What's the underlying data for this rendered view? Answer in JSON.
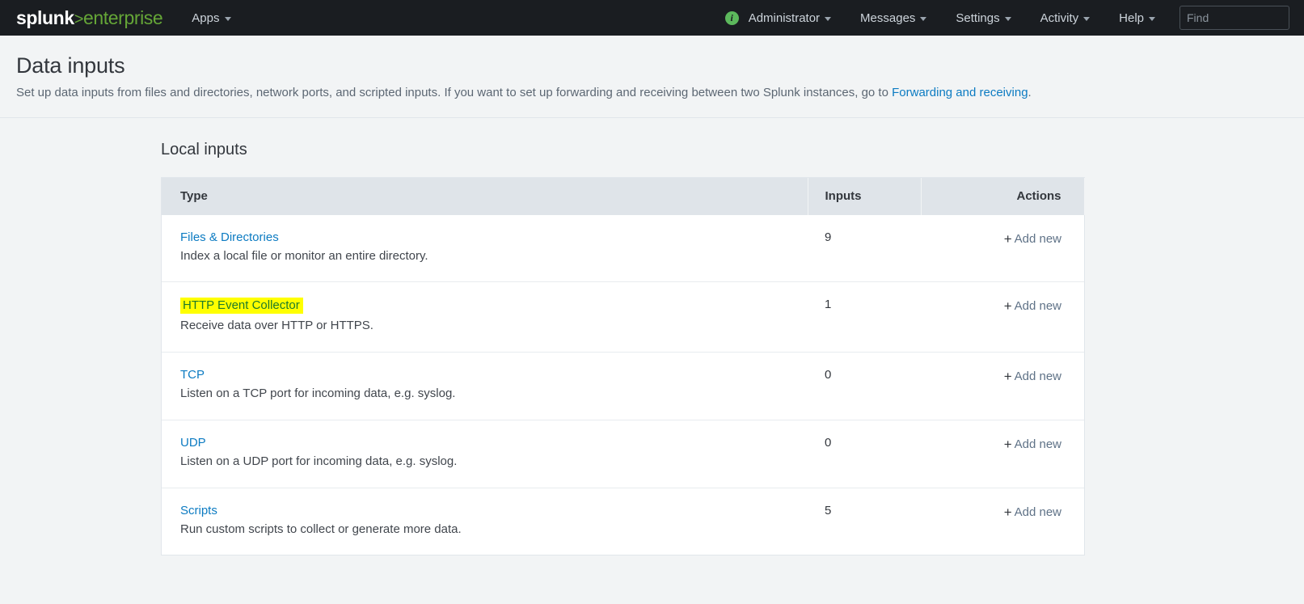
{
  "appbar": {
    "logo": {
      "part1": "splunk",
      "part2": ">",
      "part3": "enterprise"
    },
    "apps_label": "Apps",
    "info_glyph": "i",
    "items": [
      {
        "label": "Administrator"
      },
      {
        "label": "Messages"
      },
      {
        "label": "Settings"
      },
      {
        "label": "Activity"
      },
      {
        "label": "Help"
      }
    ],
    "find": {
      "placeholder": "Find",
      "value": ""
    }
  },
  "page": {
    "title": "Data inputs",
    "description_before": "Set up data inputs from files and directories, network ports, and scripted inputs. If you want to set up forwarding and receiving between two Splunk instances, go to ",
    "description_link": "Forwarding and receiving",
    "description_after": "."
  },
  "section": {
    "title": "Local inputs",
    "columns": {
      "type": "Type",
      "inputs": "Inputs",
      "actions": "Actions"
    },
    "action_label": "Add new",
    "action_plus": "+",
    "rows": [
      {
        "name": "Files & Directories",
        "description": "Index a local file or monitor an entire directory.",
        "inputs": "9",
        "highlighted": false
      },
      {
        "name": "HTTP Event Collector",
        "description": "Receive data over HTTP or HTTPS.",
        "inputs": "1",
        "highlighted": true
      },
      {
        "name": "TCP",
        "description": "Listen on a TCP port for incoming data, e.g. syslog.",
        "inputs": "0",
        "highlighted": false
      },
      {
        "name": "UDP",
        "description": "Listen on a UDP port for incoming data, e.g. syslog.",
        "inputs": "0",
        "highlighted": false
      },
      {
        "name": "Scripts",
        "description": "Run custom scripts to collect or generate more data.",
        "inputs": "5",
        "highlighted": false
      }
    ]
  },
  "colors": {
    "navbar_bg": "#1a1d21",
    "brand_green": "#65a637",
    "link_blue": "#0c7bc2",
    "highlight_yellow": "#ffff00",
    "highlight_text_green": "#1d7a2b",
    "page_bg": "#f2f4f5",
    "table_header_bg": "#dfe4e9"
  }
}
